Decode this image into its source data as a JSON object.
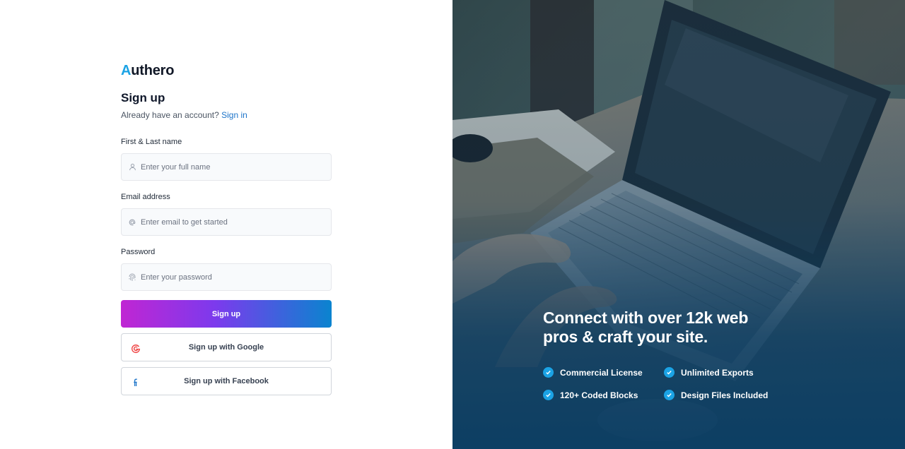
{
  "brand": {
    "accent_letter": "A",
    "rest": "uthero",
    "accent_color": "#1ba3e5"
  },
  "form": {
    "title": "Sign up",
    "subtitle_prefix": "Already have an account?",
    "signin_link": "Sign in",
    "fields": [
      {
        "label": "First & Last name",
        "placeholder": "Enter your full name",
        "icon": "user-icon"
      },
      {
        "label": "Email address",
        "placeholder": "Enter email to get started",
        "icon": "at-icon"
      },
      {
        "label": "Password",
        "placeholder": "Enter your password",
        "icon": "fingerprint-icon"
      }
    ],
    "submit_label": "Sign up",
    "google_label": "Sign up with Google",
    "facebook_label": "Sign up with Facebook"
  },
  "promo": {
    "headline_line1": "Connect with over 12k web",
    "headline_line2": "pros & craft your site.",
    "features": [
      "Commercial License",
      "Unlimited Exports",
      "120+ Coded Blocks",
      "Design Files Included"
    ],
    "check_color": "#1ba3e5"
  }
}
